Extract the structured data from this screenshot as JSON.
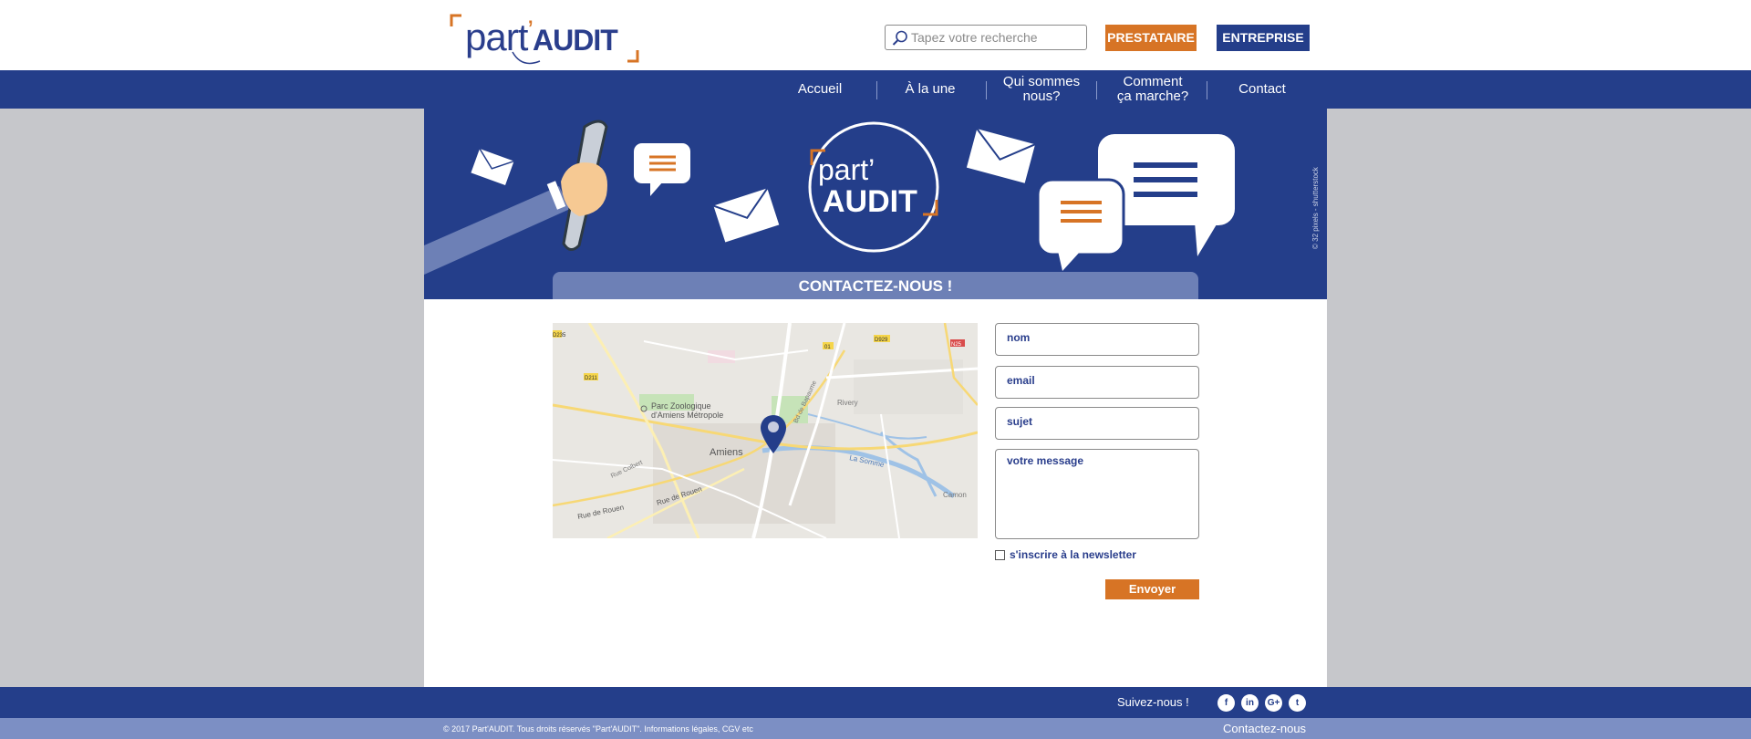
{
  "header": {
    "logo_text_light": "part",
    "logo_apostrophe": "’",
    "logo_text_bold": "AUDIT",
    "search_placeholder": "Tapez votre recherche",
    "btn_prestataire": "PRESTATAIRE",
    "btn_entreprise": "ENTREPRISE"
  },
  "nav": {
    "items": [
      {
        "label": "Accueil"
      },
      {
        "label": "À la une"
      },
      {
        "label": "Qui sommes\nnous?"
      },
      {
        "label": "Comment\nça marche?"
      },
      {
        "label": "Contact"
      }
    ]
  },
  "banner": {
    "logo_line1": "part’",
    "logo_line2": "AUDIT",
    "credit": "© 32 pixels - shutterstock",
    "title": "CONTACTEZ-NOUS !"
  },
  "map": {
    "labels": {
      "parc": "Parc Zoologique",
      "parc2": "d'Amiens Métropole",
      "city": "Amiens",
      "rivery": "Rivery",
      "somme": "La Somme",
      "camon": "Camon",
      "rue_rouen1": "Rue de Rouen",
      "rue_rouen2": "Rue de Rouen",
      "rue_colbert": "Rue Colbert",
      "rue_bapaume": "Bd de Bapaume",
      "road_d211": "D211",
      "road_d929": "D929",
      "road_01": "01",
      "road_n25": "N25",
      "road_d235": "D235"
    }
  },
  "form": {
    "nom_placeholder": "nom",
    "email_placeholder": "email",
    "sujet_placeholder": "sujet",
    "message_placeholder": "votre message",
    "newsletter_label": "s'inscrire à la newsletter",
    "send_label": "Envoyer"
  },
  "footer": {
    "follow": "Suivez-nous !",
    "social": [
      {
        "icon": "facebook-icon",
        "glyph": "f"
      },
      {
        "icon": "linkedin-icon",
        "glyph": "in"
      },
      {
        "icon": "googleplus-icon",
        "glyph": "G+"
      },
      {
        "icon": "twitter-icon",
        "glyph": "t"
      }
    ],
    "copyright": "© 2017 Part'AUDIT. Tous droits réservés \"Part'AUDIT\". Informations légales, CGV etc",
    "contact_link": "Contactez-nous"
  },
  "colors": {
    "brand_blue": "#243e8a",
    "brand_orange": "#d77425",
    "light_blue": "#7c8fc4"
  }
}
